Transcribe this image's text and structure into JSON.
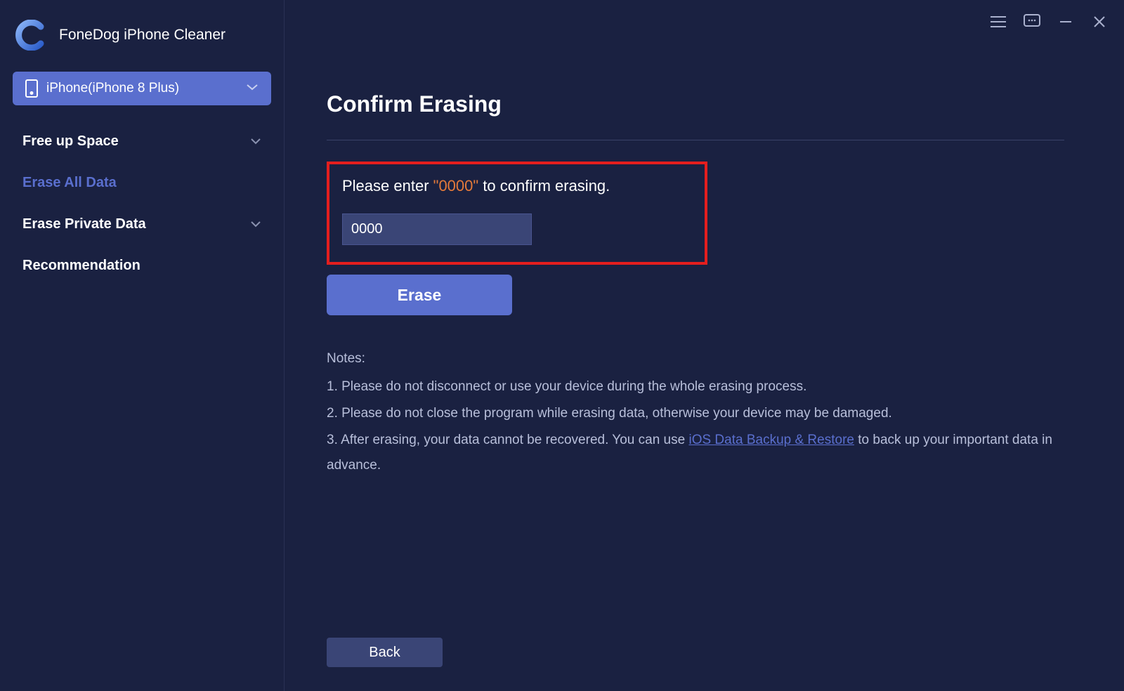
{
  "app": {
    "title": "FoneDog iPhone Cleaner"
  },
  "device": {
    "label": "iPhone(iPhone 8 Plus)"
  },
  "sidebar": {
    "items": [
      {
        "label": "Free up Space"
      },
      {
        "label": "Erase All Data"
      },
      {
        "label": "Erase Private Data"
      },
      {
        "label": "Recommendation"
      }
    ]
  },
  "main": {
    "title": "Confirm Erasing",
    "instruction_pre": "Please enter ",
    "instruction_code": "\"0000\"",
    "instruction_post": " to confirm erasing.",
    "input_value": "0000",
    "erase_label": "Erase",
    "notes_heading": "Notes:",
    "note1": "1. Please do not disconnect or use your device during the whole erasing process.",
    "note2": "2. Please do not close the program while erasing data, otherwise your device may be damaged.",
    "note3_pre": "3. After erasing, your data cannot be recovered. You can use ",
    "note3_link": "iOS Data Backup & Restore",
    "note3_post": " to back up your important data in advance.",
    "back_label": "Back"
  }
}
